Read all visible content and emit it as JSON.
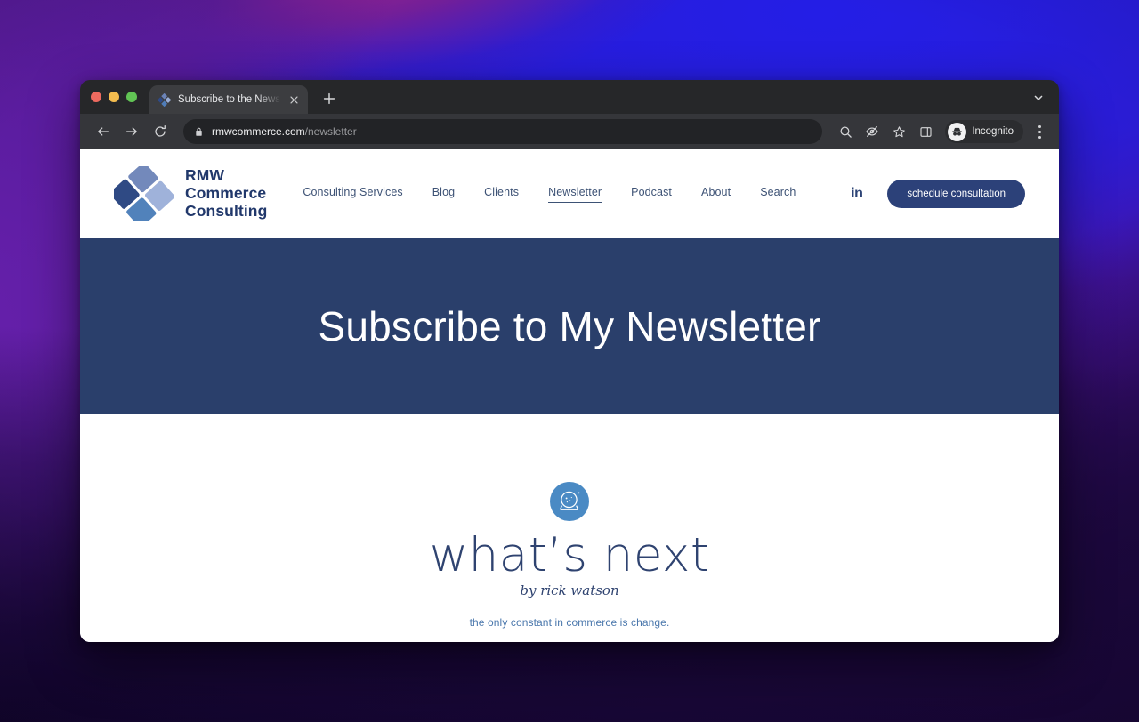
{
  "browser": {
    "tab": {
      "title": "Subscribe to the Newsletter by",
      "favicon_name": "rmw-logo-favicon",
      "close_icon": "close-icon",
      "new_tab_icon": "plus-icon",
      "tabstrip_chevron_icon": "chevron-down-icon"
    },
    "toolbar": {
      "back_icon": "back-arrow-icon",
      "forward_icon": "forward-arrow-icon",
      "reload_icon": "reload-icon",
      "lock_icon": "lock-icon",
      "url_host": "rmwcommerce.com",
      "url_path": "/newsletter",
      "url_full": "rmwcommerce.com/newsletter",
      "search_icon": "search-icon",
      "eye_off_icon": "eye-off-icon",
      "bookmark_icon": "star-icon",
      "side_panel_icon": "side-panel-icon",
      "profile_icon": "incognito-avatar-icon",
      "profile_label": "Incognito",
      "menu_icon": "kebab-menu-icon"
    },
    "window_controls": {
      "close": "close-traffic-light",
      "minimize": "minimize-traffic-light",
      "maximize": "maximize-traffic-light"
    }
  },
  "site": {
    "brand": {
      "logo_name": "rmw-commerce-consulting-logo",
      "line1": "RMW",
      "line2": "Commerce",
      "line3": "Consulting"
    },
    "nav": [
      {
        "label": "Consulting Services",
        "active": false
      },
      {
        "label": "Blog",
        "active": false
      },
      {
        "label": "Clients",
        "active": false
      },
      {
        "label": "Newsletter",
        "active": true
      },
      {
        "label": "Podcast",
        "active": false
      },
      {
        "label": "About",
        "active": false
      },
      {
        "label": "Search",
        "active": false
      }
    ],
    "header_right": {
      "linkedin_label": "in",
      "cta_label": "schedule consultation"
    },
    "hero": {
      "title": "Subscribe to My Newsletter",
      "background_color": "#2a3f6b"
    },
    "newsletter": {
      "icon_name": "crystal-ball-icon",
      "wordmark": "what’s next",
      "byline": "by rick watson",
      "tagline": "the only constant in commerce is change.",
      "accent_color": "#4a77ac",
      "text_color": "#2f4370"
    }
  }
}
